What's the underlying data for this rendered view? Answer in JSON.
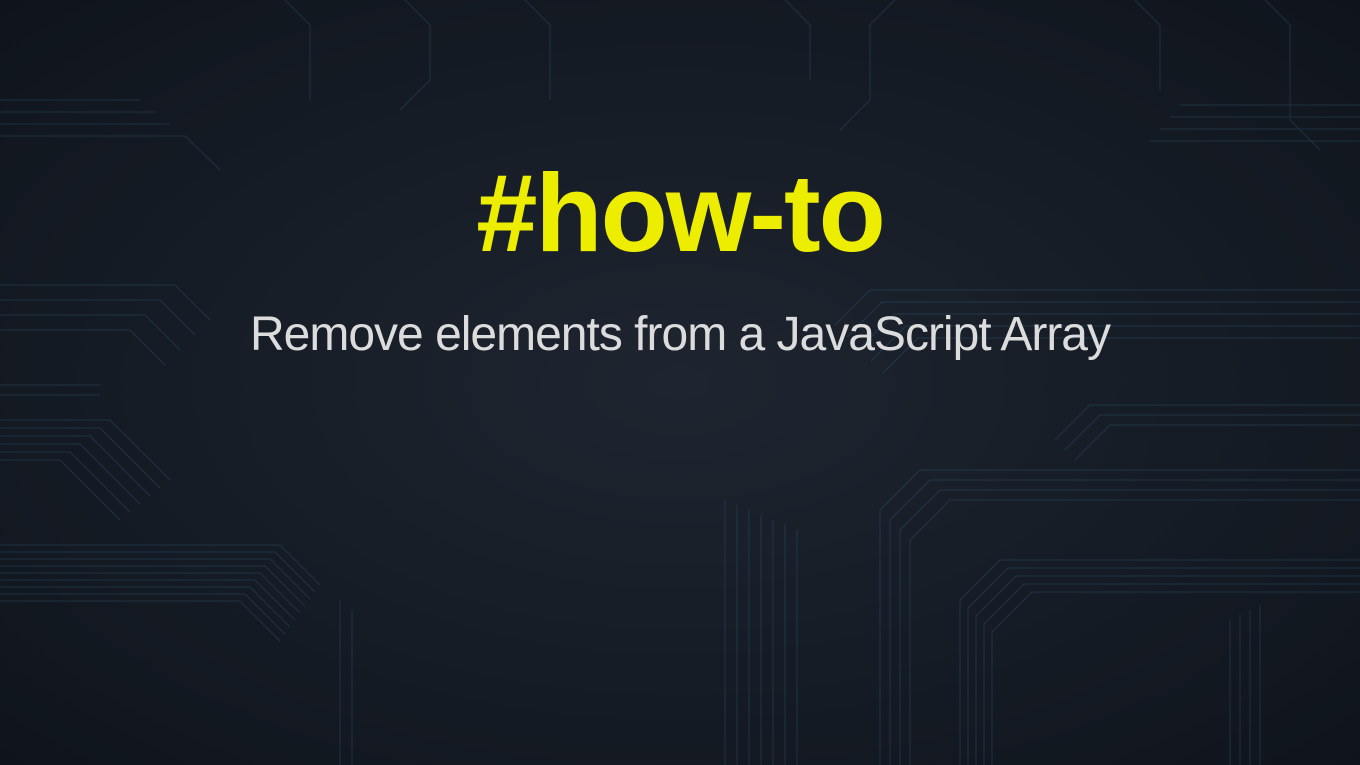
{
  "heading": "#how-to",
  "subtitle": "Remove elements from a JavaScript Array"
}
